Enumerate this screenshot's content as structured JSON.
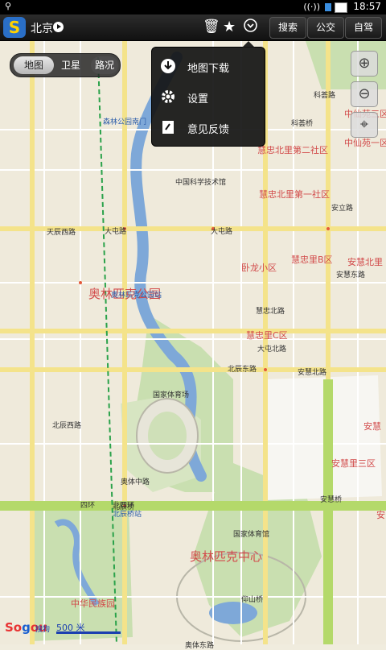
{
  "status_bar": {
    "time": "18:57"
  },
  "top_bar": {
    "city": "北京",
    "buttons": [
      "搜索",
      "公交",
      "自驾"
    ],
    "icons": [
      "trash-icon",
      "star-icon",
      "chevron-down-icon"
    ]
  },
  "map_type": {
    "items": [
      "地图",
      "卫星"
    ],
    "traffic": "路况",
    "selected": "地图"
  },
  "menu": {
    "items": [
      {
        "label": "地图下载",
        "icon": "download-icon"
      },
      {
        "label": "设置",
        "icon": "gear-icon"
      },
      {
        "label": "意见反馈",
        "icon": "feedback-icon"
      }
    ]
  },
  "map_labels": {
    "big": [
      "奥林匹克公园",
      "奥林匹克中心"
    ],
    "districts": [
      "慧忠北里第二社区",
      "慧忠北里第一社区",
      "卧龙小区",
      "慧忠里B区",
      "安慧北里",
      "慧忠里C区",
      "中华民族园",
      "中仙苑三区",
      "中仙苑一区",
      "安慧里三区",
      "安慧",
      "安"
    ],
    "roads": [
      "大屯路",
      "北辰东路",
      "北四环",
      "四环",
      "安慧桥",
      "科荟路",
      "北辰西路",
      "慧忠北路",
      "大屯路",
      "安慧北路",
      "中国科学技术馆",
      "国家体育场",
      "国家体育馆",
      "北辰桥",
      "仰山桥",
      "大屯北路",
      "天辰西路",
      "奥体东路",
      "奥体中路",
      "科荟桥",
      "安立路",
      "安慧东路"
    ],
    "metro": [
      "森林公园南门",
      "奥林匹克公园站",
      "北辰桥站"
    ]
  },
  "scale": {
    "label": "500 米"
  },
  "branding": {
    "logo": "Sogou",
    "sub": "搜狗"
  }
}
